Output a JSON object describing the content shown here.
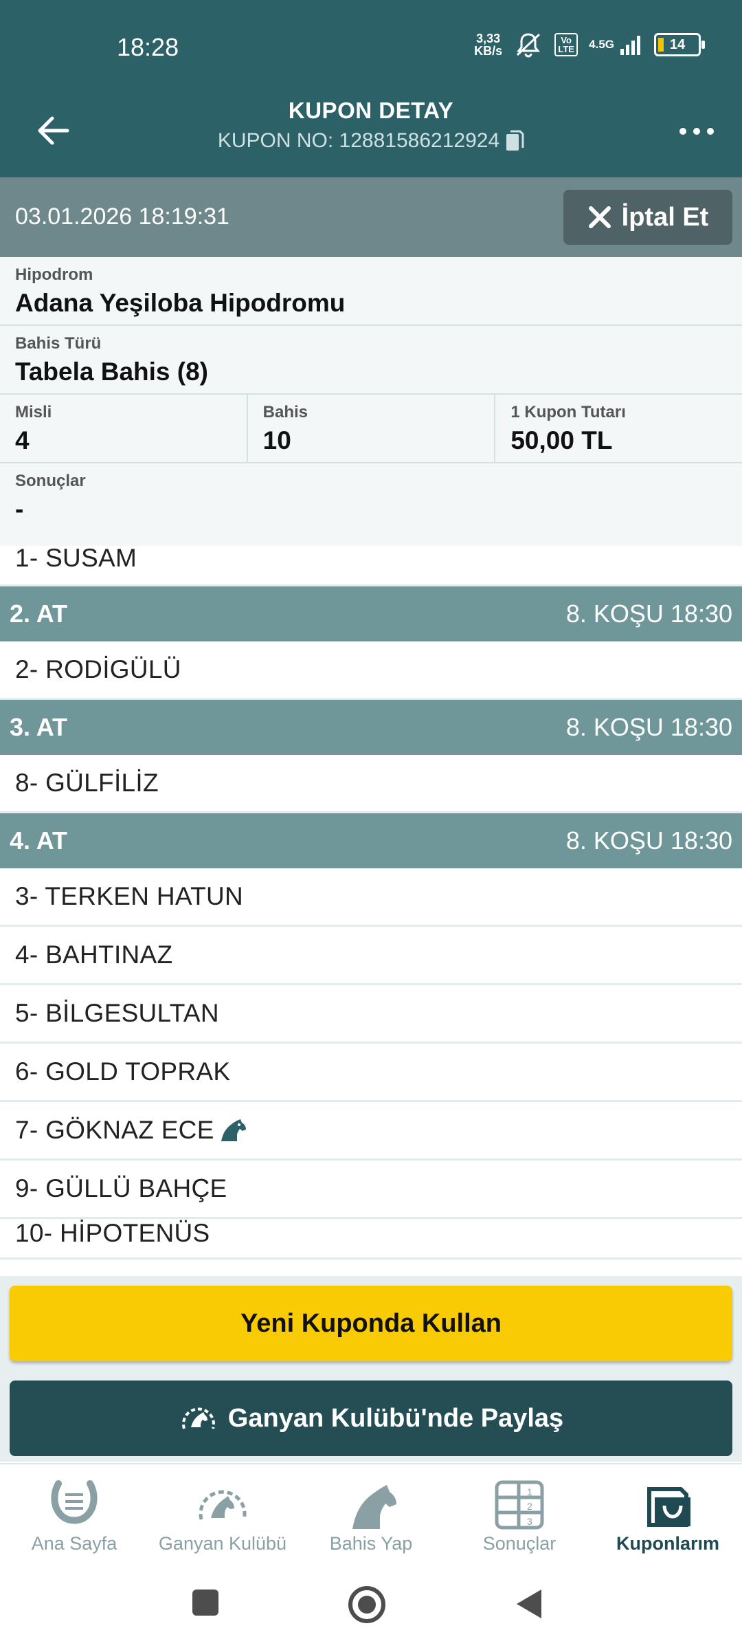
{
  "status_bar": {
    "time": "18:28",
    "net_speed_value": "3,33",
    "net_speed_unit": "KB/s",
    "network_type": "4.5G",
    "battery": "14",
    "volte_label": "Vo LTE"
  },
  "header": {
    "title": "KUPON DETAY",
    "coupon_no_label": "KUPON NO: 12881586212924"
  },
  "coupon": {
    "datetime": "03.01.2026 18:19:31",
    "cancel_label": "İptal Et",
    "hippodrome_label": "Hipodrom",
    "hippodrome_value": "Adana Yeşiloba Hipodromu",
    "bet_type_label": "Bahis Türü",
    "bet_type_value": "Tabela Bahis (8)",
    "misli_label": "Misli",
    "misli_value": "4",
    "bahis_label": "Bahis",
    "bahis_value": "10",
    "amount_label": "1 Kupon Tutarı",
    "amount_value": "50,00 TL",
    "results_label": "Sonuçlar",
    "results_value": "-"
  },
  "legs": {
    "first_horse": "1- SUSAM",
    "leg2": {
      "title": "2. AT",
      "race": "8. KOŞU 18:30",
      "horses": [
        "2- RODİGÜLÜ"
      ]
    },
    "leg3": {
      "title": "3. AT",
      "race": "8. KOŞU 18:30",
      "horses": [
        "8- GÜLFİLİZ"
      ]
    },
    "leg4": {
      "title": "4. AT",
      "race": "8. KOŞU 18:30",
      "horses": [
        "3- TERKEN HATUN",
        "4- BAHTINAZ",
        "5- BİLGESULTAN",
        "6- GOLD TOPRAK",
        "7- GÖKNAZ ECE",
        "9- GÜLLÜ BAHÇE",
        "10- HİPOTENÜS"
      ]
    }
  },
  "actions": {
    "new_coupon": "Yeni Kuponda Kullan",
    "share": "Ganyan Kulübü'nde Paylaş"
  },
  "nav": {
    "items": [
      {
        "label": "Ana Sayfa",
        "icon": "horseshoe-icon"
      },
      {
        "label": "Ganyan Kulübü",
        "icon": "club-icon"
      },
      {
        "label": "Bahis Yap",
        "icon": "horse-head-icon"
      },
      {
        "label": "Sonuçlar",
        "icon": "results-grid-icon"
      },
      {
        "label": "Kuponlarım",
        "icon": "coupons-icon"
      }
    ],
    "active_index": 4
  },
  "colors": {
    "header": "#2c6168",
    "leg_header": "#6f9699",
    "primary_button": "#f9cb05",
    "share_button": "#244d54",
    "active_nav": "#1f4a52"
  }
}
